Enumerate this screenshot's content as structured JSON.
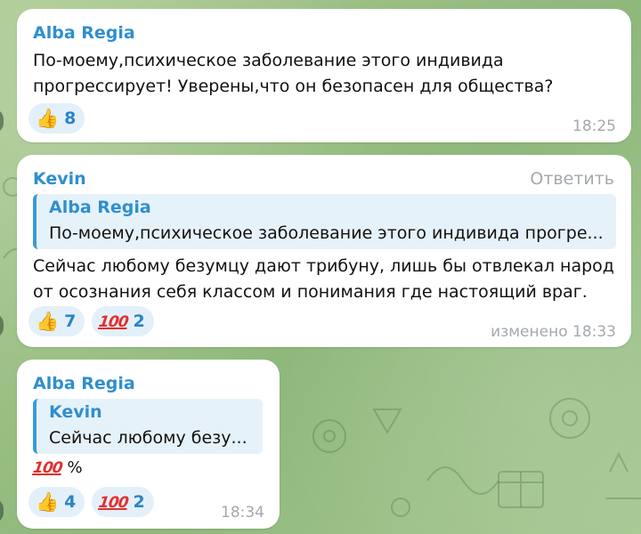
{
  "messages": [
    {
      "author": "Alba Regia",
      "text_lines": [
        "По-моему,психическое заболевание этого индивида",
        "прогрессирует! Уверены,что он безопасен для общества?"
      ],
      "reactions": [
        {
          "emoji_name": "thumbs-up-icon",
          "count": "8"
        }
      ],
      "time": "18:25"
    },
    {
      "author": "Kevin",
      "reply_action": "Ответить",
      "quote": {
        "author": "Alba Regia",
        "text": "По-моему,психическое заболевание этого индивида прогре..."
      },
      "text_lines": [
        "Сейчас любому безумцу дают трибуну, лишь бы отвлекал народ",
        "от осознания себя классом и понимания где настоящий враг."
      ],
      "reactions": [
        {
          "emoji_name": "thumbs-up-icon",
          "count": "7"
        },
        {
          "emoji_name": "hundred-points-icon",
          "count": "2"
        }
      ],
      "time": "изменено 18:33"
    },
    {
      "author": "Alba Regia",
      "quote": {
        "author": "Kevin",
        "text": "Сейчас любому безу..."
      },
      "text_after_emoji": "%",
      "reactions": [
        {
          "emoji_name": "thumbs-up-icon",
          "count": "4"
        },
        {
          "emoji_name": "hundred-points-icon",
          "count": "2"
        }
      ],
      "time": "18:34"
    }
  ],
  "colors": {
    "author": "#2e8fcf",
    "reaction_bg": "#e3f0fa",
    "quote_bg": "#e6f2f9",
    "quote_border": "#3a9ad9",
    "meta": "#a3a9ae",
    "chat_bg": "#9cbf84"
  }
}
